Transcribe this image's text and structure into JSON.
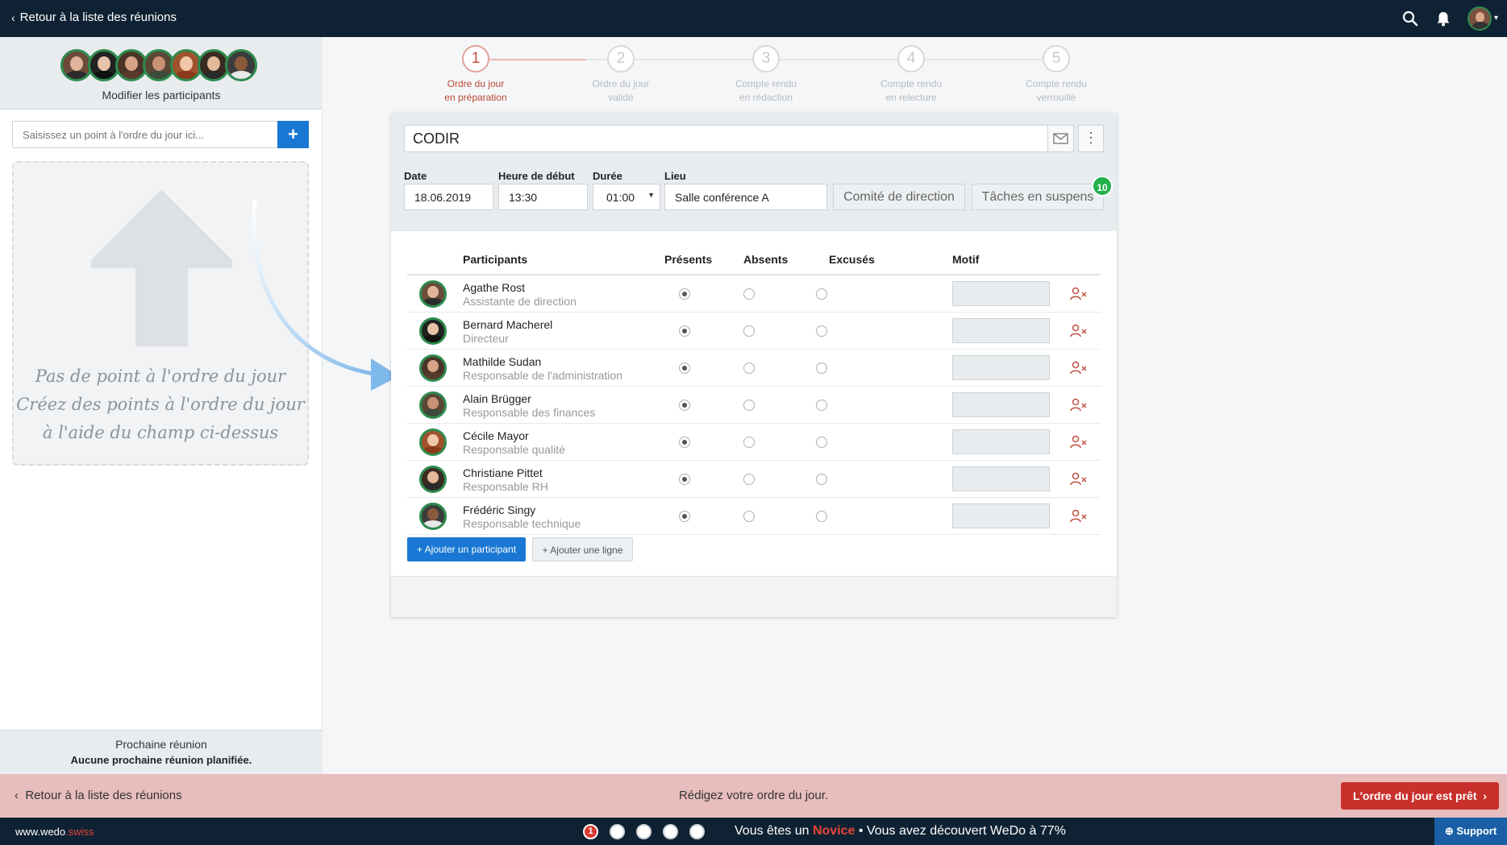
{
  "topbar": {
    "back_label": "Retour à la liste des réunions"
  },
  "sidebar": {
    "modify_participants": "Modifier les participants",
    "agenda_placeholder": "Saisissez un point à l'ordre du jour ici...",
    "add_button": "+",
    "empty_line1": "Pas de point à l'ordre du jour",
    "empty_line2": "Créez des points à l'ordre du jour",
    "empty_line3": "à l'aide du champ ci-dessus",
    "next_meeting_label": "Prochaine réunion",
    "next_meeting_value": "Aucune prochaine réunion planifiée."
  },
  "stepper": [
    {
      "num": "1",
      "line1": "Ordre du jour",
      "line2": "en préparation",
      "active": true
    },
    {
      "num": "2",
      "line1": "Ordre du jour",
      "line2": "validé",
      "active": false
    },
    {
      "num": "3",
      "line1": "Compte rendu",
      "line2": "en rédaction",
      "active": false
    },
    {
      "num": "4",
      "line1": "Compte rendu",
      "line2": "en relecture",
      "active": false
    },
    {
      "num": "5",
      "line1": "Compte rendu",
      "line2": "verrouillé",
      "active": false
    }
  ],
  "meeting": {
    "title": "CODIR",
    "date_label": "Date",
    "date_value": "18.06.2019",
    "start_label": "Heure de début",
    "start_value": "13:30",
    "duration_label": "Durée",
    "duration_value": "01:00",
    "location_label": "Lieu",
    "location_value": "Salle conférence A",
    "committee_button": "Comité de direction",
    "pending_tasks_button": "Tâches en suspens",
    "pending_tasks_count": "10"
  },
  "table": {
    "headers": {
      "participants": "Participants",
      "present": "Présents",
      "absent": "Absents",
      "excused": "Excusés",
      "reason": "Motif"
    },
    "rows": [
      {
        "name": "Agathe Rost",
        "role": "Assistante de direction",
        "status": "present"
      },
      {
        "name": "Bernard Macherel",
        "role": "Directeur",
        "status": "present"
      },
      {
        "name": "Mathilde Sudan",
        "role": "Responsable de l'administration",
        "status": "present"
      },
      {
        "name": "Alain Brügger",
        "role": "Responsable des finances",
        "status": "present"
      },
      {
        "name": "Cécile Mayor",
        "role": "Responsable qualité",
        "status": "present"
      },
      {
        "name": "Christiane Pittet",
        "role": "Responsable RH",
        "status": "present"
      },
      {
        "name": "Frédéric Singy",
        "role": "Responsable technique",
        "status": "present"
      }
    ],
    "add_participant": "+ Ajouter un participant",
    "add_line": "+ Ajouter une ligne"
  },
  "actionbar": {
    "back_label": "Retour à la liste des réunions",
    "message": "Rédigez votre ordre du jour.",
    "ready_button": "L'ordre du jour est prêt"
  },
  "footer": {
    "site_prefix": "www.wedo",
    "site_suffix": ".swiss",
    "active_dot": "1",
    "progress_prefix": "Vous êtes un ",
    "progress_level": "Novice",
    "progress_suffix": " • Vous avez découvert WeDo à 77%",
    "support_label": "Support"
  },
  "colors": {
    "accent_blue": "#1a78d4",
    "danger_red": "#c9302c",
    "dark_nav": "#0f2233",
    "success_green": "#22b14c"
  }
}
